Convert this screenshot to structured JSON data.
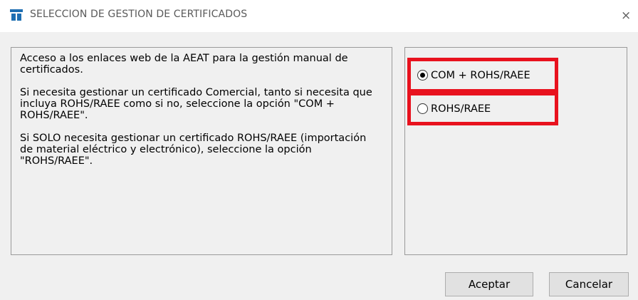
{
  "window": {
    "title": "SELECCION DE GESTION DE CERTIFICADOS",
    "close_symbol": "×",
    "app_icon": "app-logo-icon",
    "accent_color": "#1f6fb2"
  },
  "info": {
    "paragraph1": "Acceso a los enlaces web de la AEAT para la gestión manual de certificados.",
    "paragraph2": "Si necesita gestionar un certificado Comercial, tanto si necesita que incluya ROHS/RAEE como si no, seleccione la opción \"COM + ROHS/RAEE\".",
    "paragraph3": "Si SOLO necesita gestionar un certificado ROHS/RAEE (importación de material eléctrico y electrónico), seleccione la opción \"ROHS/RAEE\"."
  },
  "options": [
    {
      "label": "COM + ROHS/RAEE",
      "selected": true
    },
    {
      "label": "ROHS/RAEE",
      "selected": false
    }
  ],
  "highlight_color": "#e8121e",
  "buttons": {
    "accept_label": "Aceptar",
    "cancel_label": "Cancelar"
  }
}
